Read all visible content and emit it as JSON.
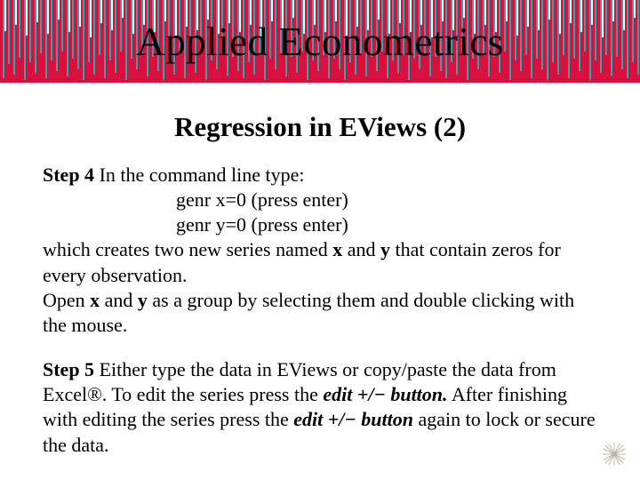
{
  "banner": {
    "title": "Applied Econometrics"
  },
  "subtitle": "Regression in EViews (2)",
  "step4": {
    "label": "Step 4",
    "lead": " In the command line type:",
    "code1": "genr x=0 (press enter)",
    "code2": "genr y=0 (press enter)",
    "tail1a": "which creates two new series named ",
    "x": "x",
    "tail1b": " and ",
    "y": "y",
    "tail1c": " that contain zeros for every observation.",
    "tail2a": "Open ",
    "tail2b": " and ",
    "tail2c": " as a group by selecting them and double clicking with the mouse."
  },
  "step5": {
    "label": "Step 5",
    "p1": " Either type the data in EViews or copy/paste the data from Excel®. To edit the series press the ",
    "btn1": "edit +/− button.",
    "p2": " After finishing with editing the series press the ",
    "btn2": "edit +/− button",
    "p3": " again to lock or secure the data."
  }
}
